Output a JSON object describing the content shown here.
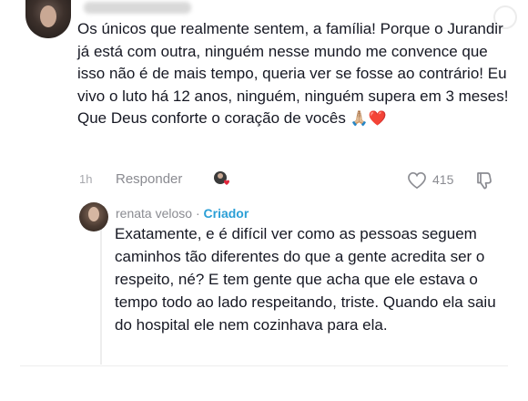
{
  "comment": {
    "username": "",
    "text": "Os únicos que realmente sentem, a família! Porque o Jurandir já está com outra, ninguém nesse mundo me convence que isso não é de mais tempo, queria ver se fosse ao contrário! Eu vivo o luto há 12 anos, ninguém, ninguém supera em 3 meses! Que Deus conforte o coração de vocês",
    "emojis": "🙏🏼❤️",
    "time": "1h",
    "reply_label": "Responder",
    "like_count": "415",
    "icons": {
      "like": "heart-outline-icon",
      "dislike": "thumbs-down-icon",
      "creator_liked": "creator-liked-heart-icon"
    }
  },
  "reply": {
    "username": "renata veloso",
    "separator": "·",
    "creator_label": "Criador",
    "text": "Exatamente, e é difícil ver como as pessoas seguem caminhos tão diferentes do que a gente acredita ser o respeito, né? E tem gente que acha que ele estava o tempo todo ao lado respeitando, triste. Quando ela saiu do hospital ele nem cozinhava para ela."
  },
  "colors": {
    "creator_accent": "#2b9fd6",
    "meta_text": "#8a8b91",
    "heart_red": "#e0243a"
  }
}
